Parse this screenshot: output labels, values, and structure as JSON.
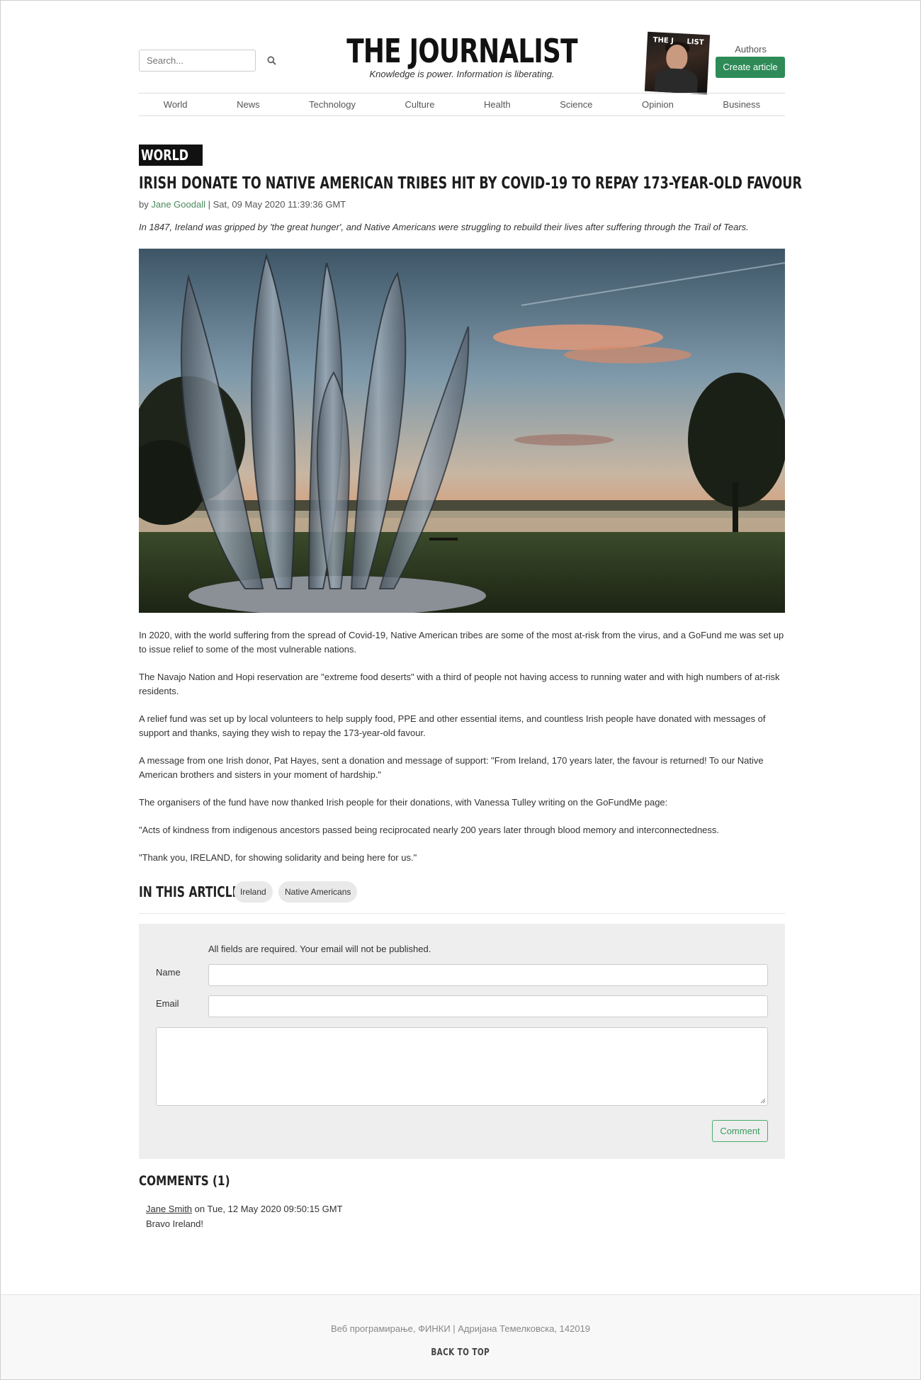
{
  "header": {
    "search_placeholder": "Search...",
    "title": "THE JOURNALIST",
    "tagline": "Knowledge is power. Information is liberating.",
    "magazine_left": "THE J",
    "magazine_right": "LIST",
    "authors_label": "Authors",
    "create_label": "Create article"
  },
  "nav": [
    "World",
    "News",
    "Technology",
    "Culture",
    "Health",
    "Science",
    "Opinion",
    "Business"
  ],
  "article": {
    "category": "WORLD",
    "headline": "IRISH DONATE TO NATIVE AMERICAN TRIBES HIT BY COVID-19 TO REPAY 173-YEAR-OLD FAVOUR",
    "by": "by",
    "author": "Jane Goodall",
    "date": "| Sat, 09 May 2020 11:39:36 GMT",
    "lead": "In 1847, Ireland was gripped by 'the great hunger', and Native Americans were struggling to rebuild their lives after suffering through the Trail of Tears.",
    "paragraphs": [
      "In 2020, with the world suffering from the spread of Covid-19, Native American tribes are some of the most at-risk from the virus, and a GoFund me was set up to issue relief to some of the most vulnerable nations.",
      "The Navajo Nation and Hopi reservation are \"extreme food deserts\" with a third of people not having access to running water and with high numbers of at-risk residents.",
      "A relief fund was set up by local volunteers to help supply food, PPE and other essential items, and countless Irish people have donated with messages of support and thanks, saying they wish to repay the 173-year-old favour.",
      "A message from one Irish donor, Pat Hayes, sent a donation and message of support: \"From Ireland, 170 years later, the favour is returned! To our Native American brothers and sisters in your moment of hardship.\"",
      "The organisers of the fund have now thanked Irish people for their donations, with Vanessa Tulley writing on the GoFundMe page:",
      "\"Acts of kindness from indigenous ancestors passed being reciprocated nearly 200 years later through blood memory and interconnectedness.",
      "\"Thank you, IRELAND, for showing solidarity and being here for us.\""
    ]
  },
  "tags": {
    "title": "IN THIS ARTICLE:",
    "items": [
      "Ireland",
      "Native Americans"
    ]
  },
  "form": {
    "note": "All fields are required. Your email will not be published.",
    "name_label": "Name",
    "email_label": "Email",
    "submit_label": "Comment"
  },
  "comments": {
    "title": "COMMENTS (1)",
    "items": [
      {
        "user": "Jane Smith",
        "date": "on Tue, 12 May 2020 09:50:15 GMT",
        "text": "Bravo Ireland!"
      }
    ]
  },
  "footer": {
    "text": "Веб програмирање, ФИНКИ | Адријана Темелковска, 142019",
    "back_to_top": "BACK TO TOP"
  }
}
